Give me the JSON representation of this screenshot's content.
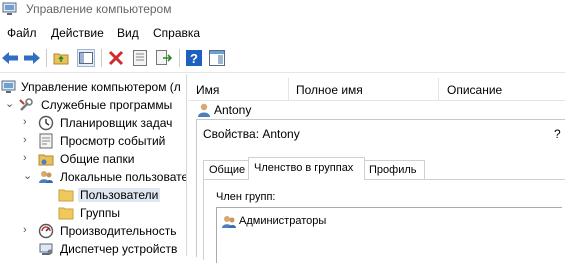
{
  "window": {
    "title": "Управление компьютером"
  },
  "menu": [
    "Файл",
    "Действие",
    "Вид",
    "Справка"
  ],
  "toolbar": {
    "buttons": [
      "back-arrow-icon",
      "forward-arrow-icon",
      "folder-up-icon",
      "show-hide-tree-icon",
      "delete-icon",
      "properties-icon",
      "export-list-icon",
      "help-icon",
      "action-pane-icon"
    ]
  },
  "tree": {
    "items": [
      {
        "label": "Управление компьютером (л",
        "level": 0,
        "expander": "",
        "icon": "computer-management-icon"
      },
      {
        "label": "Служебные программы",
        "level": 1,
        "expander": "⌄",
        "icon": "tools-icon"
      },
      {
        "label": "Планировщик задач",
        "level": 2,
        "expander": "›",
        "icon": "clock-icon"
      },
      {
        "label": "Просмотр событий",
        "level": 2,
        "expander": "›",
        "icon": "event-viewer-icon"
      },
      {
        "label": "Общие папки",
        "level": 2,
        "expander": "›",
        "icon": "shared-folder-icon"
      },
      {
        "label": "Локальные пользовате",
        "level": 2,
        "expander": "⌄",
        "icon": "users-icon"
      },
      {
        "label": "Пользователи",
        "level": 3,
        "expander": "",
        "icon": "folder-icon",
        "selected": true
      },
      {
        "label": "Группы",
        "level": 3,
        "expander": "",
        "icon": "folder-icon"
      },
      {
        "label": "Производительность",
        "level": 2,
        "expander": "›",
        "icon": "performance-icon"
      },
      {
        "label": "Диспетчер устройств",
        "level": 2,
        "expander": "",
        "icon": "device-manager-icon"
      }
    ]
  },
  "list": {
    "columns": [
      "Имя",
      "Полное имя",
      "Описание"
    ],
    "rows": [
      {
        "name": "Antony"
      }
    ]
  },
  "dialog": {
    "title": "Свойства: Antony",
    "help": "?",
    "tabs": [
      "Общие",
      "Членство в группах",
      "Профиль"
    ],
    "active_tab": "Членство в группах",
    "member_label": "Член групп:",
    "members": [
      "Администраторы"
    ]
  },
  "colors": {
    "selection": "#dfe7f0",
    "accent_red": "#d12b2b",
    "help_blue": "#1f5fbf"
  }
}
